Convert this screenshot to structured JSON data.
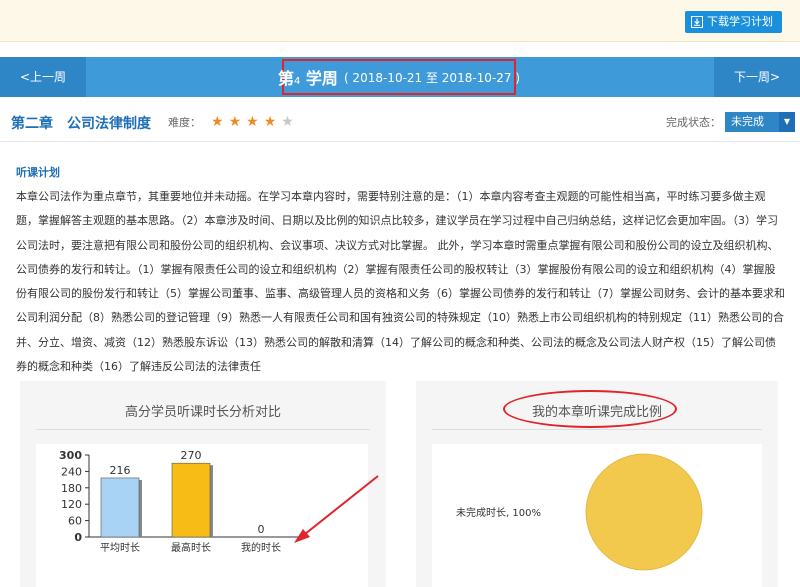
{
  "toolbar": {
    "download_label": "下载学习计划",
    "download_icon": "download-icon"
  },
  "week": {
    "prev_label": "<上一周",
    "next_label": "下一周>",
    "title_prefix": "第",
    "title_num": "4",
    "title_suffix": " 学周",
    "range": "( 2018-10-21 至 2018-10-27 )"
  },
  "chapter": {
    "title": "第二章　公司法律制度",
    "difficulty_label": "难度：",
    "difficulty_stars": 4,
    "difficulty_max": 5,
    "status_label": "完成状态：",
    "status_value": "未完成"
  },
  "plan": {
    "label": "听课计划",
    "text": "本章公司法作为重点章节，其重要地位并未动摇。在学习本章内容时，需要特别注意的是：（1）本章内容考查主观题的可能性相当高，平时练习要多做主观题，掌握解答主观题的基本思路。（2）本章涉及时间、日期以及比例的知识点比较多，建议学员在学习过程中自己归纳总结，这样记忆会更加牢固。（3）学习公司法时，要注意把有限公司和股份公司的组织机构、会议事项、决议方式对比掌握。 此外，学习本章时需重点掌握有限公司和股份公司的设立及组织机构、公司债券的发行和转让。（1）掌握有限责任公司的设立和组织机构（2）掌握有限责任公司的股权转让（3）掌握股份有限公司的设立和组织机构（4）掌握股份有限公司的股份发行和转让（5）掌握公司董事、监事、高级管理人员的资格和义务（6）掌握公司债券的发行和转让（7）掌握公司财务、会计的基本要求和公司利润分配（8）熟悉公司的登记管理（9）熟悉一人有限责任公司和国有独资公司的特殊规定（10）熟悉上市公司组织机构的特别规定（11）熟悉公司的合并、分立、增资、减资（12）熟悉股东诉讼（13）熟悉公司的解散和清算（14）了解公司的概念和种类、公司法的概念及公司法人财产权（15）了解公司债券的概念和种类（16）了解违反公司法的法律责任"
  },
  "panels": {
    "left_title": "高分学员听课时长分析对比",
    "right_title": "我的本章听课完成比例"
  },
  "chart_data": [
    {
      "type": "bar",
      "title": "",
      "categories": [
        "平均时长",
        "最高时长",
        "我的时长"
      ],
      "values": [
        216,
        270,
        0
      ],
      "ylim": [
        0,
        300
      ],
      "yticks": [
        0,
        60,
        120,
        180,
        240,
        300
      ],
      "colors": [
        "#a9d3f5",
        "#f7bd16",
        "#a9d3f5"
      ],
      "grid": false
    },
    {
      "type": "pie",
      "title": "",
      "slices": [
        {
          "label": "未完成时长",
          "value": 100,
          "display": "未完成时长, 100%",
          "color": "#f2c94c"
        }
      ]
    }
  ]
}
